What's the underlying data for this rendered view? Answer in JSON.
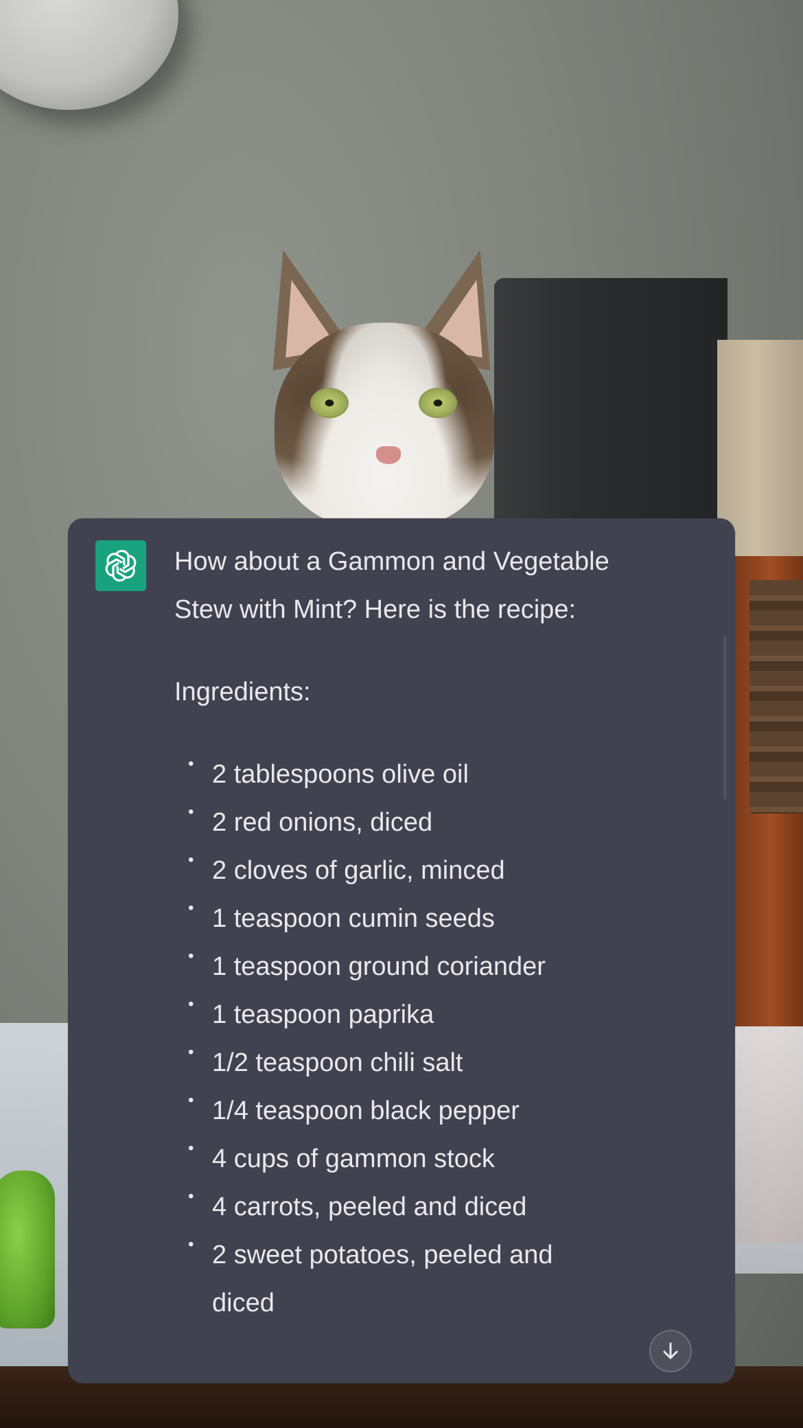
{
  "background": {
    "description_icon": "photo-background"
  },
  "assistant": {
    "avatar_icon": "openai-logo-icon",
    "avatar_color": "#19a27e",
    "intro": "How about a Gammon and Vegetable Stew with Mint? Here is the recipe:",
    "ingredients_heading": "Ingredients:",
    "ingredients": [
      "2 tablespoons olive oil",
      "2 red onions, diced",
      "2 cloves of garlic, minced",
      "1 teaspoon cumin seeds",
      "1 teaspoon ground coriander",
      "1 teaspoon paprika",
      "1/2 teaspoon chili salt",
      "1/4 teaspoon black pepper",
      "4 cups of gammon stock",
      "4 carrots, peeled and diced",
      "2 sweet potatoes, peeled and diced"
    ]
  },
  "card_color": "#41424f",
  "scroll_down_icon": "arrow-down-icon"
}
